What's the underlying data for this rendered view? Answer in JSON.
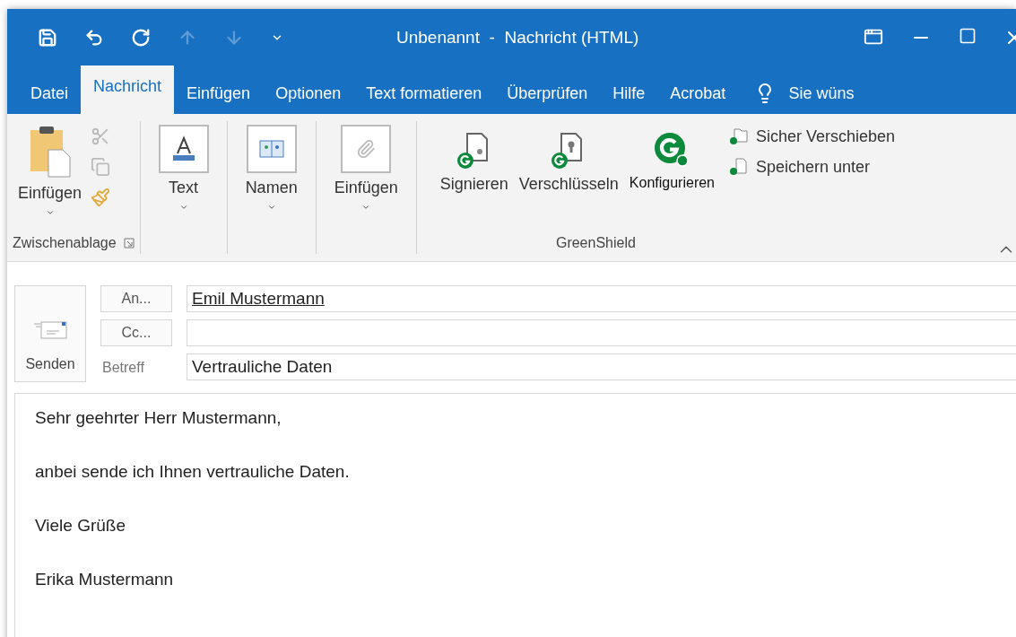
{
  "quick_access": [
    {
      "kind": "save",
      "disabled": false
    },
    {
      "kind": "undo",
      "disabled": false
    },
    {
      "kind": "redo",
      "disabled": false
    },
    {
      "kind": "up",
      "disabled": true
    },
    {
      "kind": "down",
      "disabled": true
    },
    {
      "kind": "customize",
      "disabled": false
    }
  ],
  "window": {
    "title": "Unbenannt  -  Nachricht (HTML)"
  },
  "tabs": [
    {
      "label": "Datei",
      "selected": false
    },
    {
      "label": "Nachricht",
      "selected": true
    },
    {
      "label": "Einfügen",
      "selected": false
    },
    {
      "label": "Optionen",
      "selected": false
    },
    {
      "label": "Text formatieren",
      "selected": false
    },
    {
      "label": "Überprüfen",
      "selected": false
    },
    {
      "label": "Hilfe",
      "selected": false
    },
    {
      "label": "Acrobat",
      "selected": false
    }
  ],
  "tell_me": "Sie wüns",
  "clipboard_group": {
    "label": "Zwischenablage",
    "paste": "Einfügen",
    "tools": [
      {
        "kind": "cut",
        "disabled": true
      },
      {
        "kind": "copy",
        "disabled": true
      },
      {
        "kind": "painter",
        "disabled": false
      }
    ]
  },
  "dropdown_groups": [
    {
      "kind": "text",
      "label": "Text"
    },
    {
      "kind": "names",
      "label": "Namen"
    },
    {
      "kind": "attach",
      "label": "Einfügen"
    }
  ],
  "greenshield_group": {
    "label": "GreenShield",
    "buttons": [
      {
        "kind": "sign",
        "label": "Signieren"
      },
      {
        "kind": "encrypt",
        "label": "Verschlüsseln"
      },
      {
        "kind": "config",
        "label": "Konfigurieren"
      }
    ],
    "small_buttons": [
      {
        "kind": "folder",
        "label": "Sicher Verschieben"
      },
      {
        "kind": "file",
        "label": "Speichern unter"
      }
    ]
  },
  "compose": {
    "send": "Senden",
    "to_button": "An...",
    "cc_button": "Cc...",
    "subject_label": "Betreff",
    "to_value": "Emil Mustermann",
    "subject_value": "Vertrauliche Daten"
  },
  "body": [
    "Sehr geehrter Herr Mustermann,",
    "anbei sende ich Ihnen vertrauliche Daten.",
    "Viele Grüße",
    "Erika Mustermann"
  ]
}
